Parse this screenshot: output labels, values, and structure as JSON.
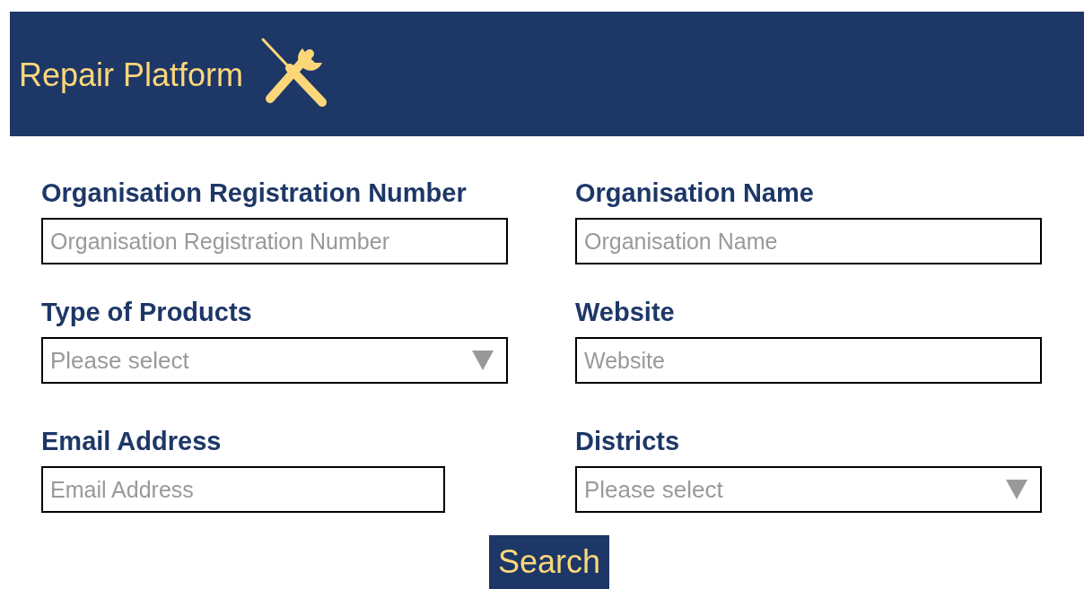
{
  "header": {
    "title": "Repair Platform"
  },
  "fields": [
    {
      "label": "Organisation Registration Number",
      "placeholder": "Organisation Registration Number",
      "kind": "text"
    },
    {
      "label": "Organisation Name",
      "placeholder": "Organisation Name",
      "kind": "text"
    },
    {
      "label": "Type of Products",
      "placeholder": "Please select",
      "kind": "select"
    },
    {
      "label": "Website",
      "placeholder": "Website",
      "kind": "text"
    },
    {
      "label": "Email Address",
      "placeholder": "Email Address",
      "kind": "text"
    },
    {
      "label": "Districts",
      "placeholder": "Please select",
      "kind": "select"
    }
  ],
  "search_button": "Search"
}
